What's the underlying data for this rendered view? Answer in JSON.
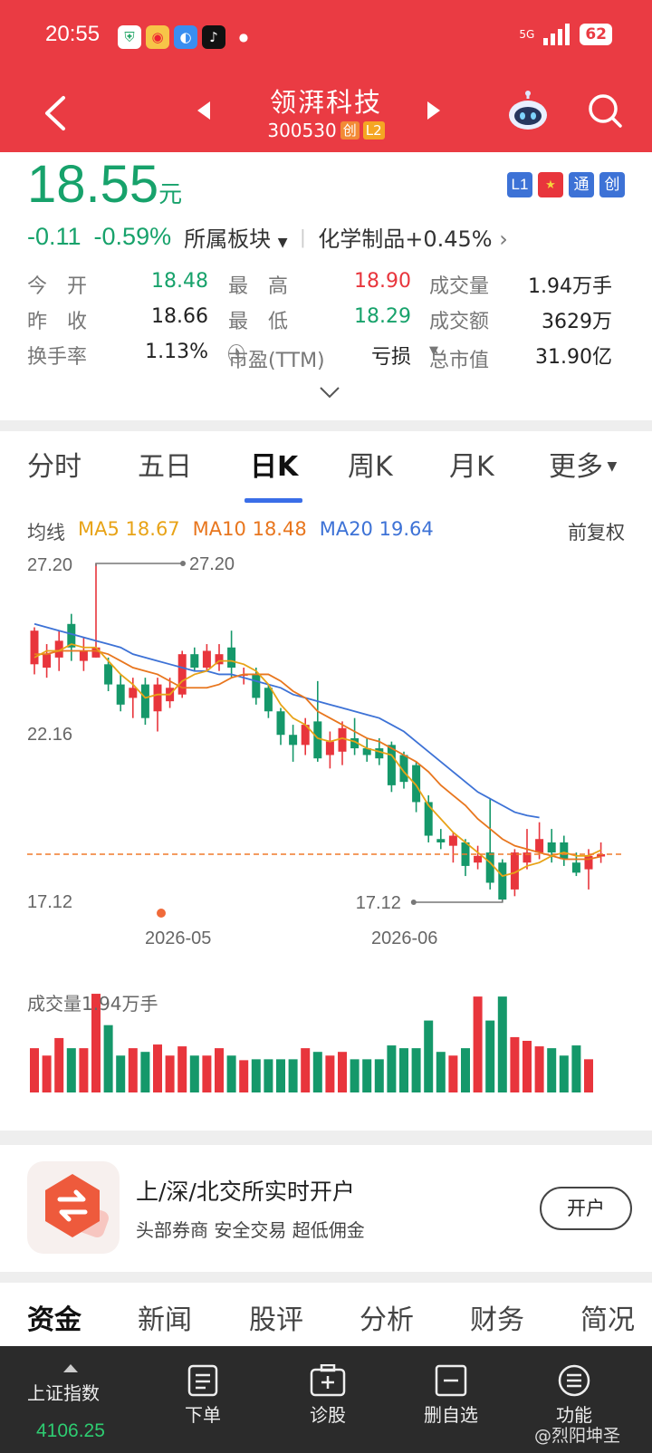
{
  "status_bar": {
    "time": "20:55",
    "network": "5G",
    "battery": "62"
  },
  "nav": {
    "title": "领湃科技",
    "code": "300530",
    "board_badge": "创",
    "level_badge": "L2"
  },
  "quote": {
    "price": "18.55",
    "unit": "元",
    "change": "-0.11",
    "change_pct": "-0.59%",
    "sector_label": "所属板块",
    "sector_value": "化学制品+0.45%",
    "tags": [
      "L1",
      "旗",
      "通",
      "创"
    ],
    "stats": [
      [
        {
          "label": "今　开",
          "value": "18.48",
          "tone": "green"
        },
        {
          "label": "最　高",
          "value": "18.90",
          "tone": "red"
        },
        {
          "label": "成交量",
          "value": "1.94万手",
          "tone": "plain"
        }
      ],
      [
        {
          "label": "昨　收",
          "value": "18.66",
          "tone": "plain"
        },
        {
          "label": "最　低",
          "value": "18.29",
          "tone": "green"
        },
        {
          "label": "成交额",
          "value": "3629万",
          "tone": "plain"
        }
      ],
      [
        {
          "label": "换手率",
          "value": "1.13%",
          "tone": "plain"
        },
        {
          "label": "市盈(TTM)",
          "value": "亏损",
          "tone": "plain"
        },
        {
          "label": "总市值",
          "value": "31.90亿",
          "tone": "plain"
        }
      ]
    ]
  },
  "kline": {
    "tabs": [
      "分时",
      "五日",
      "日K",
      "周K",
      "月K",
      "更多"
    ],
    "active_tab": "日K",
    "ma_label": "均线",
    "ma": [
      {
        "name": "MA5",
        "value": "18.67",
        "color": "#e8a317"
      },
      {
        "name": "MA10",
        "value": "18.48",
        "color": "#e8761e"
      },
      {
        "name": "MA20",
        "value": "19.64",
        "color": "#3d72d6"
      }
    ],
    "adjust_label": "前复权",
    "volume_label": "成交量1.94万手"
  },
  "chart_data": {
    "type": "candlestick",
    "ylim": [
      17.12,
      27.2
    ],
    "y_ticks": [
      "27.20",
      "22.16",
      "17.12"
    ],
    "x_ticks": [
      "2026-05",
      "2026-06"
    ],
    "max_label": "27.20",
    "min_label": "17.12",
    "current_price": 18.55,
    "candles": [
      {
        "o": 24.2,
        "c": 25.2,
        "h": 25.3,
        "l": 23.9
      },
      {
        "o": 24.1,
        "c": 24.5,
        "h": 24.8,
        "l": 23.8
      },
      {
        "o": 24.4,
        "c": 24.9,
        "h": 25.2,
        "l": 24.0
      },
      {
        "o": 25.4,
        "c": 24.7,
        "h": 25.7,
        "l": 24.3
      },
      {
        "o": 24.3,
        "c": 24.6,
        "h": 25.0,
        "l": 24.0
      },
      {
        "o": 24.4,
        "c": 24.7,
        "h": 27.2,
        "l": 24.4
      },
      {
        "o": 24.2,
        "c": 23.6,
        "h": 24.4,
        "l": 23.4
      },
      {
        "o": 23.6,
        "c": 23.0,
        "h": 23.9,
        "l": 22.8
      },
      {
        "o": 23.2,
        "c": 23.5,
        "h": 23.8,
        "l": 22.6
      },
      {
        "o": 23.6,
        "c": 22.6,
        "h": 23.8,
        "l": 22.4
      },
      {
        "o": 22.8,
        "c": 23.6,
        "h": 23.8,
        "l": 22.2
      },
      {
        "o": 23.1,
        "c": 23.5,
        "h": 23.8,
        "l": 22.9
      },
      {
        "o": 23.3,
        "c": 24.5,
        "h": 24.6,
        "l": 23.2
      },
      {
        "o": 24.5,
        "c": 24.1,
        "h": 24.7,
        "l": 24.0
      },
      {
        "o": 24.1,
        "c": 24.6,
        "h": 24.8,
        "l": 24.0
      },
      {
        "o": 24.2,
        "c": 24.5,
        "h": 24.8,
        "l": 24.0
      },
      {
        "o": 24.7,
        "c": 24.1,
        "h": 25.2,
        "l": 23.8
      },
      {
        "o": 23.9,
        "c": 23.9,
        "h": 24.1,
        "l": 23.6
      },
      {
        "o": 23.9,
        "c": 23.2,
        "h": 24.1,
        "l": 23.0
      },
      {
        "o": 23.5,
        "c": 22.8,
        "h": 23.6,
        "l": 22.6
      },
      {
        "o": 22.8,
        "c": 22.1,
        "h": 22.9,
        "l": 21.8
      },
      {
        "o": 22.1,
        "c": 21.8,
        "h": 22.4,
        "l": 21.3
      },
      {
        "o": 21.8,
        "c": 22.4,
        "h": 22.6,
        "l": 21.5
      },
      {
        "o": 22.5,
        "c": 21.4,
        "h": 23.7,
        "l": 21.3
      },
      {
        "o": 21.5,
        "c": 21.9,
        "h": 22.2,
        "l": 21.1
      },
      {
        "o": 21.6,
        "c": 22.3,
        "h": 22.5,
        "l": 21.2
      },
      {
        "o": 22.0,
        "c": 21.7,
        "h": 22.6,
        "l": 21.5
      },
      {
        "o": 21.7,
        "c": 21.5,
        "h": 22.0,
        "l": 21.3
      },
      {
        "o": 21.7,
        "c": 21.4,
        "h": 22.0,
        "l": 21.2
      },
      {
        "o": 21.8,
        "c": 20.6,
        "h": 21.9,
        "l": 20.4
      },
      {
        "o": 21.5,
        "c": 20.7,
        "h": 21.6,
        "l": 20.5
      },
      {
        "o": 21.2,
        "c": 20.1,
        "h": 21.3,
        "l": 19.8
      },
      {
        "o": 20.1,
        "c": 19.1,
        "h": 20.3,
        "l": 18.9
      },
      {
        "o": 19.0,
        "c": 18.9,
        "h": 19.3,
        "l": 18.7
      },
      {
        "o": 18.8,
        "c": 19.1,
        "h": 19.2,
        "l": 18.3
      },
      {
        "o": 18.9,
        "c": 18.2,
        "h": 19.0,
        "l": 17.9
      },
      {
        "o": 18.3,
        "c": 18.5,
        "h": 18.8,
        "l": 18.1
      },
      {
        "o": 18.6,
        "c": 17.7,
        "h": 20.2,
        "l": 17.5
      },
      {
        "o": 18.3,
        "c": 17.2,
        "h": 18.4,
        "l": 17.12
      },
      {
        "o": 17.5,
        "c": 18.6,
        "h": 18.7,
        "l": 17.3
      },
      {
        "o": 18.3,
        "c": 18.6,
        "h": 19.3,
        "l": 18.1
      },
      {
        "o": 18.6,
        "c": 19.0,
        "h": 19.5,
        "l": 18.4
      },
      {
        "o": 18.9,
        "c": 18.6,
        "h": 19.3,
        "l": 18.3
      },
      {
        "o": 18.9,
        "c": 18.4,
        "h": 19.1,
        "l": 18.2
      },
      {
        "o": 18.3,
        "c": 18.0,
        "h": 18.6,
        "l": 17.9
      },
      {
        "o": 18.1,
        "c": 18.5,
        "h": 18.7,
        "l": 17.5
      },
      {
        "o": 18.48,
        "c": 18.55,
        "h": 18.9,
        "l": 18.29
      }
    ],
    "ma5": [
      24.4,
      24.6,
      24.6,
      24.8,
      24.7,
      24.7,
      24.3,
      23.9,
      23.6,
      23.2,
      23.3,
      23.3,
      23.7,
      23.9,
      24.0,
      24.3,
      24.3,
      24.2,
      24.0,
      23.6,
      23.0,
      22.6,
      22.4,
      22.0,
      21.9,
      22.0,
      21.9,
      21.7,
      21.6,
      21.5,
      21.0,
      20.6,
      20.0,
      19.6,
      19.2,
      18.9,
      18.6,
      18.3,
      17.9,
      18.0,
      18.2,
      18.3,
      18.5,
      18.6,
      18.5,
      18.5,
      18.67
    ],
    "ma10": [
      24.5,
      24.5,
      24.6,
      24.6,
      24.6,
      24.6,
      24.5,
      24.3,
      24.1,
      24.0,
      23.9,
      23.7,
      23.5,
      23.5,
      23.5,
      23.6,
      23.8,
      23.9,
      23.9,
      23.9,
      23.7,
      23.4,
      23.2,
      22.8,
      22.6,
      22.4,
      22.2,
      22.0,
      21.9,
      21.7,
      21.5,
      21.3,
      21.0,
      20.6,
      20.3,
      20.0,
      19.6,
      19.3,
      19.0,
      18.8,
      18.7,
      18.6,
      18.5,
      18.4,
      18.4,
      18.4,
      18.48
    ],
    "ma20": [
      25.4,
      25.3,
      25.2,
      25.1,
      25.0,
      24.9,
      24.8,
      24.7,
      24.5,
      24.4,
      24.3,
      24.2,
      24.1,
      24.0,
      24.0,
      23.9,
      23.9,
      23.8,
      23.7,
      23.6,
      23.5,
      23.3,
      23.2,
      23.1,
      23.0,
      22.9,
      22.8,
      22.7,
      22.6,
      22.4,
      22.2,
      21.9,
      21.6,
      21.3,
      21.0,
      20.7,
      20.4,
      20.2,
      20.0,
      19.8,
      19.7,
      19.64
    ],
    "volume": [
      48,
      40,
      59,
      48,
      48,
      107,
      73,
      40,
      48,
      44,
      52,
      40,
      50,
      40,
      40,
      48,
      40,
      35,
      36,
      36,
      36,
      36,
      48,
      44,
      40,
      44,
      36,
      36,
      36,
      51,
      48,
      48,
      78,
      44,
      40,
      48,
      104,
      78,
      104,
      60,
      56,
      50,
      48,
      40,
      51,
      36
    ]
  },
  "ad": {
    "title": "上/深/北交所实时开户",
    "subtitle": "头部券商  安全交易  超低佣金",
    "button": "开户"
  },
  "sub_tabs": [
    "资金",
    "新闻",
    "股评",
    "分析",
    "财务",
    "简况"
  ],
  "bottom_nav": {
    "index_name": "上证指数",
    "index_value": "4106.25",
    "items": [
      "下单",
      "诊股",
      "删自选",
      "功能"
    ],
    "watermark": "@烈阳坤圣"
  }
}
